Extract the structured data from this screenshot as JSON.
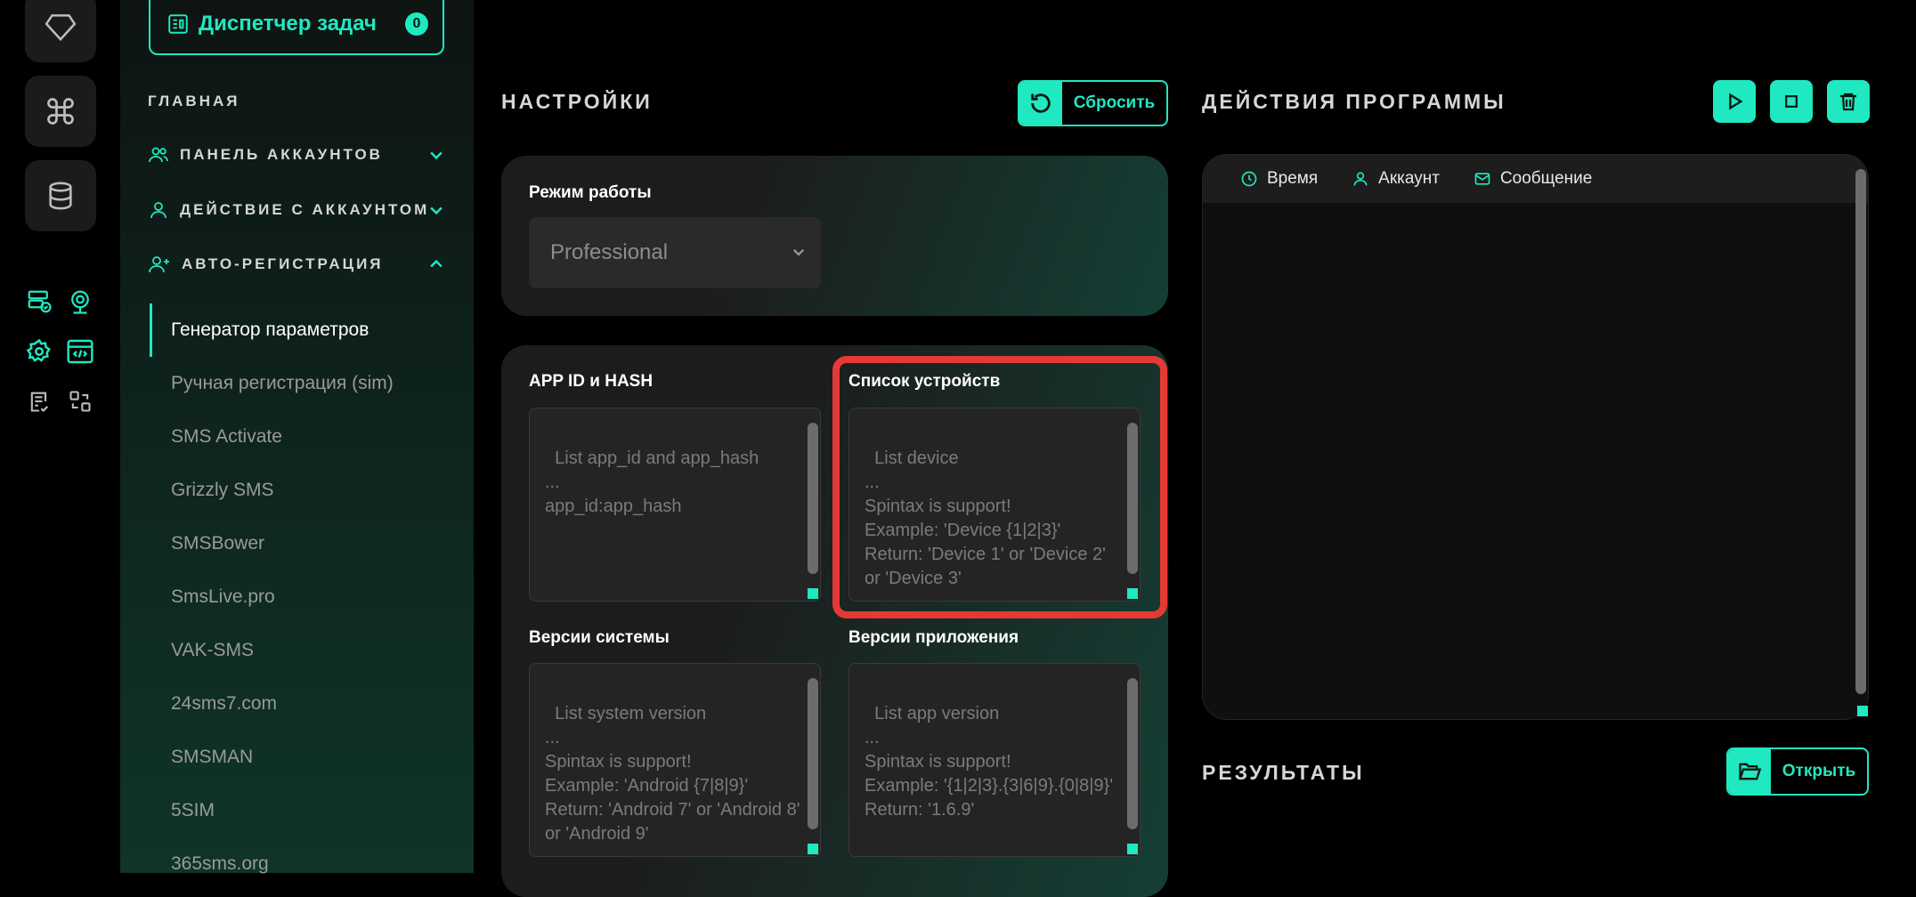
{
  "app": {
    "task_manager_label": "Диспетчер задач",
    "task_count": "0"
  },
  "sidebar": {
    "main_heading": "ГЛАВНАЯ",
    "groups": [
      {
        "label": "ПАНЕЛЬ АККАУНТОВ",
        "icon": "users-icon",
        "state": "collapsed"
      },
      {
        "label": "ДЕЙСТВИЕ С АККАУНТОМ",
        "icon": "user-icon",
        "state": "collapsed"
      },
      {
        "label": "АВТО-РЕГИСТРАЦИЯ",
        "icon": "user-plus-icon",
        "state": "expanded"
      }
    ],
    "items": [
      "Генератор параметров",
      "Ручная регистрация (sim)",
      "SMS Activate",
      "Grizzly SMS",
      "SMSBower",
      "SmsLive.pro",
      "VAK-SMS",
      "24sms7.com",
      "SMSMAN",
      "5SIM",
      "365sms.org"
    ],
    "active_item": "Генератор параметров"
  },
  "settings": {
    "title": "НАСТРОЙКИ",
    "reset_label": "Сбросить",
    "mode_label": "Режим работы",
    "mode_value": "Professional",
    "fields": {
      "app_id": {
        "label": "APP ID и HASH",
        "placeholder": "List app_id and app_hash\n...\napp_id:app_hash"
      },
      "devices": {
        "label": "Список устройств",
        "placeholder": "List device\n...\nSpintax is support!\nExample: 'Device {1|2|3}'\nReturn: 'Device 1' or 'Device 2' or 'Device 3'"
      },
      "system_versions": {
        "label": "Версии системы",
        "placeholder": "List system version\n...\nSpintax is support!\nExample: 'Android {7|8|9}'\nReturn: 'Android 7' or 'Android 8' or 'Android 9'"
      },
      "app_versions": {
        "label": "Версии приложения",
        "placeholder": "List app version\n...\nSpintax is support!\nExample: '{1|2|3}.{3|6|9}.{0|8|9}'\nReturn: '1.6.9'"
      }
    }
  },
  "actions": {
    "title": "ДЕЙСТВИЯ ПРОГРАММЫ",
    "columns": [
      "Время",
      "Аккаунт",
      "Сообщение"
    ]
  },
  "results": {
    "title": "РЕЗУЛЬТАТЫ",
    "open_label": "Открыть"
  },
  "colors": {
    "accent": "#20e8c0",
    "highlight": "#e53935"
  }
}
